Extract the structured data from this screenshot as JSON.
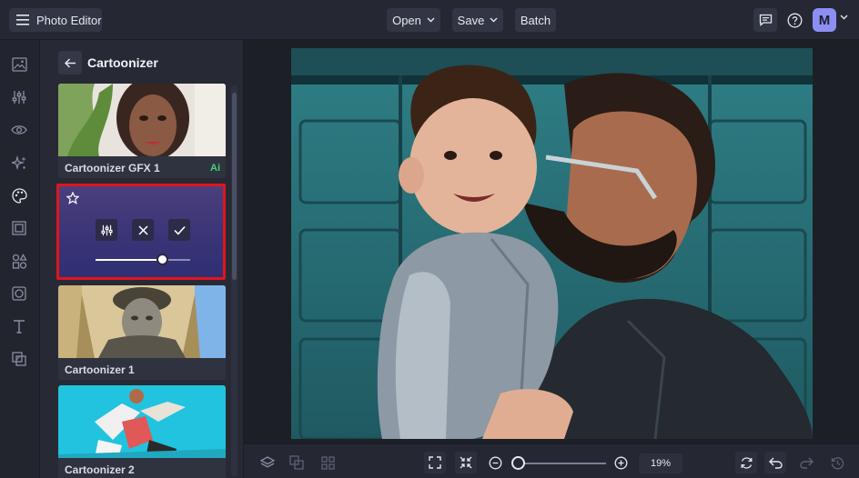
{
  "topbar": {
    "app_title": "Photo Editor",
    "open_label": "Open",
    "save_label": "Save",
    "batch_label": "Batch",
    "avatar_initial": "M"
  },
  "panel": {
    "title": "Cartoonizer",
    "items": [
      {
        "label": "Cartoonizer GFX 1",
        "badge": "Ai"
      },
      {
        "label": "Cartoonizer 1"
      },
      {
        "label": "Cartoonizer 2"
      }
    ],
    "active_effect": {
      "intensity": 0.71
    }
  },
  "bottombar": {
    "zoom_label": "19%"
  },
  "colors": {
    "accent": "#8b8ff4",
    "highlight_border": "#e1141c",
    "ai_badge": "#46d37a"
  }
}
